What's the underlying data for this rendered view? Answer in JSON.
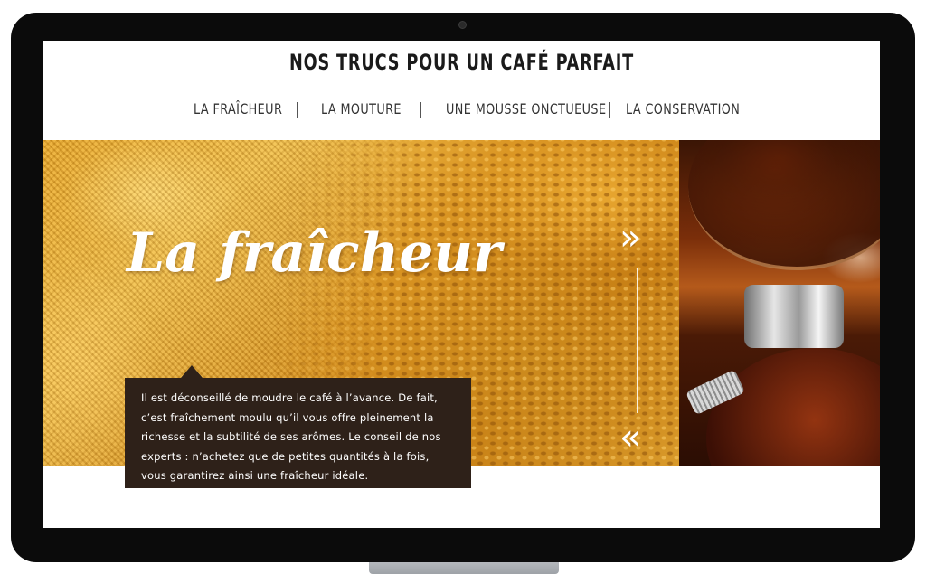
{
  "header": {
    "title": "NOS TRUCS POUR UN CAFÉ PARFAIT"
  },
  "nav": {
    "items": [
      {
        "label": "LA FRAÎCHEUR"
      },
      {
        "label": "LA MOUTURE"
      },
      {
        "label": "UNE MOUSSE ONCTUEUSE"
      },
      {
        "label": "LA CONSERVATION"
      }
    ]
  },
  "hero": {
    "heading": "La fraîcheur",
    "next_arrow": "»",
    "prev_arrow": "«",
    "caption": "Il est déconseillé de moudre le café à l’avance. De fait, c’est fraîchement moulu qu’il vous offre pleinement la richesse et la subtilité de ses arômes. Le conseil de nos experts : n’achetez que de petites quantités à la fois, vous garantirez ainsi une fraîcheur idéale."
  },
  "icons": {
    "next": "double-chevron-right-icon",
    "prev": "double-chevron-left-icon"
  },
  "colors": {
    "caption_bg": "#2e2119",
    "title_text": "#1a1a1a",
    "nav_text": "#333333"
  }
}
